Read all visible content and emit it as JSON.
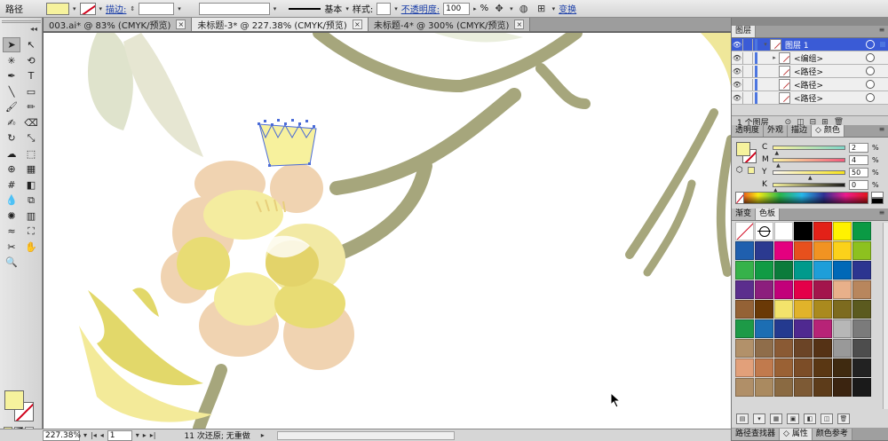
{
  "control_bar": {
    "object_type": "路径",
    "stroke_label": "描边:",
    "line_style": "基本",
    "style_label": "样式:",
    "opacity_label": "不透明度:",
    "opacity_value": "100",
    "opacity_unit": "%",
    "transform_label": "变换",
    "fill_color": "#f6f29d"
  },
  "tabs": [
    {
      "label": "003.ai* @ 83% (CMYK/预览)",
      "active": false
    },
    {
      "label": "未标题-3* @ 227.38% (CMYK/预览)",
      "active": true
    },
    {
      "label": "未标题-4* @ 300% (CMYK/预览)",
      "active": false
    }
  ],
  "tools": [
    {
      "name": "selection-tool-icon",
      "glyph": "➤",
      "active": true
    },
    {
      "name": "direct-selection-tool-icon",
      "glyph": "↖"
    },
    {
      "name": "magic-wand-tool-icon",
      "glyph": "✳"
    },
    {
      "name": "lasso-tool-icon",
      "glyph": "⟲"
    },
    {
      "name": "pen-tool-icon",
      "glyph": "✒"
    },
    {
      "name": "type-tool-icon",
      "glyph": "T"
    },
    {
      "name": "line-tool-icon",
      "glyph": "╲"
    },
    {
      "name": "rectangle-tool-icon",
      "glyph": "▭"
    },
    {
      "name": "paintbrush-tool-icon",
      "glyph": "🖌"
    },
    {
      "name": "pencil-tool-icon",
      "glyph": "✏"
    },
    {
      "name": "blob-brush-tool-icon",
      "glyph": "✍"
    },
    {
      "name": "eraser-tool-icon",
      "glyph": "⌫"
    },
    {
      "name": "rotate-tool-icon",
      "glyph": "↻"
    },
    {
      "name": "scale-tool-icon",
      "glyph": "⤡"
    },
    {
      "name": "warp-tool-icon",
      "glyph": "☁"
    },
    {
      "name": "free-transform-tool-icon",
      "glyph": "⬚"
    },
    {
      "name": "shape-builder-tool-icon",
      "glyph": "⊕"
    },
    {
      "name": "perspective-grid-tool-icon",
      "glyph": "▦"
    },
    {
      "name": "mesh-tool-icon",
      "glyph": "#"
    },
    {
      "name": "gradient-tool-icon",
      "glyph": "◧"
    },
    {
      "name": "eyedropper-tool-icon",
      "glyph": "💧"
    },
    {
      "name": "blend-tool-icon",
      "glyph": "⧉"
    },
    {
      "name": "symbol-sprayer-tool-icon",
      "glyph": "✺"
    },
    {
      "name": "column-graph-tool-icon",
      "glyph": "▥"
    },
    {
      "name": "width-tool-icon",
      "glyph": "≈"
    },
    {
      "name": "artboard-tool-icon",
      "glyph": "⛶"
    },
    {
      "name": "slice-tool-icon",
      "glyph": "✂"
    },
    {
      "name": "hand-tool-icon",
      "glyph": "✋"
    },
    {
      "name": "zoom-tool-icon",
      "glyph": "🔍"
    }
  ],
  "status_bar": {
    "zoom": "227.38%",
    "artboard": "1",
    "undo_info": "11 次还原; 无重做"
  },
  "layers_panel": {
    "tabs": [
      "图层"
    ],
    "rows": [
      {
        "label": "图层 1",
        "selected": true,
        "indent": 0,
        "twist": "▾"
      },
      {
        "label": "<编组>",
        "selected": false,
        "indent": 1,
        "twist": "▸"
      },
      {
        "label": "<路径>",
        "selected": false,
        "indent": 1,
        "twist": ""
      },
      {
        "label": "<路径>",
        "selected": false,
        "indent": 1,
        "twist": ""
      },
      {
        "label": "<路径>",
        "selected": false,
        "indent": 1,
        "twist": ""
      }
    ],
    "footer": "1 个图层"
  },
  "color_panel": {
    "tabs": [
      "透明度",
      "外观",
      "描边",
      "颜色"
    ],
    "active_tab": 3,
    "sliders": [
      {
        "label": "C",
        "value": "2",
        "gradient": "linear-gradient(90deg,#fbf29d,#7ed6c8)"
      },
      {
        "label": "M",
        "value": "4",
        "gradient": "linear-gradient(90deg,#f8f3a0,#f25a7c)"
      },
      {
        "label": "Y",
        "value": "50",
        "gradient": "linear-gradient(90deg,#fbf7f2,#f6e21a)"
      },
      {
        "label": "K",
        "value": "0",
        "gradient": "linear-gradient(90deg,#f6f29d,#1a1a1a)"
      }
    ],
    "unit": "%"
  },
  "swatches_panel": {
    "tabs": [
      "渐变",
      "色板"
    ],
    "active_tab": 1,
    "swatches": [
      "none",
      "reg",
      "#ffffff",
      "#000000",
      "#e32118",
      "#fff200",
      "#0a9a44",
      "#1f5fae",
      "#2b3a90",
      "#e4007f",
      "#e7501d",
      "#f19322",
      "#fbd11b",
      "#8dc11f",
      "#36b24a",
      "#119b44",
      "#0b7b3b",
      "#009a8c",
      "#1e9ed9",
      "#0068b7",
      "#2c3590",
      "#5b2e8d",
      "#8c1e7d",
      "#c2007a",
      "#e40049",
      "#a3154c",
      "#e8b08a",
      "#b8865d",
      "#946236",
      "#6a3906",
      "#f3e36b",
      "#e1b32a",
      "#aa8a1e",
      "#7d6b1f",
      "#5b5a1f",
      "#1d9a47",
      "#1c6eb3",
      "#243a8f",
      "#4f2990",
      "#b72377",
      "#b7b7b7",
      "#7b7b7b",
      "#b2916a",
      "#8f6d4a",
      "#8a5a34",
      "#6b4426",
      "#553215",
      "#999999",
      "#4d4d4d",
      "#e2a07a",
      "#c17a4d",
      "#9a6134",
      "#7c4d27",
      "#5a3713",
      "#3f2a10",
      "#222222",
      "#b08f68",
      "#aa8a60",
      "#8a6a42",
      "#7d5a35",
      "#5d3c1a",
      "#3b2410",
      "#1a1a1a"
    ]
  },
  "bottom_tabs": [
    "路径查找器",
    "属性",
    "颜色参考"
  ],
  "bottom_active": 1
}
